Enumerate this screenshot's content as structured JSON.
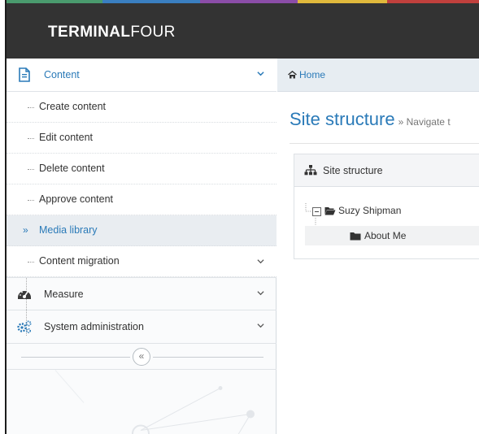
{
  "header": {
    "logo_bold": "TERMINAL",
    "logo_light": "FOUR",
    "stripe_colors": [
      "#4a9b6e",
      "#3a7fc1",
      "#8b4da8",
      "#e0b93c",
      "#c1403d"
    ]
  },
  "sidebar": {
    "sections": [
      {
        "label": "Content",
        "icon": "document-icon",
        "expanded": true
      },
      {
        "label": "Measure",
        "icon": "dashboard-icon",
        "expanded": false
      },
      {
        "label": "System administration",
        "icon": "gears-icon",
        "expanded": false
      }
    ],
    "content_items": [
      {
        "label": "Create content"
      },
      {
        "label": "Edit content"
      },
      {
        "label": "Delete content"
      },
      {
        "label": "Approve content"
      },
      {
        "label": "Media library",
        "selected": true,
        "marker": "»"
      },
      {
        "label": "Content migration",
        "has_children": true
      }
    ],
    "collapse_glyph": "«"
  },
  "breadcrumb": {
    "home_label": "Home"
  },
  "page": {
    "title": "Site structure",
    "subtitle": "» Navigate t"
  },
  "panel": {
    "title": "Site structure",
    "tree": {
      "root_label": "Suzy Shipman",
      "children": [
        {
          "label": "About Me"
        }
      ]
    }
  },
  "colors": {
    "accent": "#2a7ab8",
    "header_bg": "#333333",
    "selected_bg": "#e9edf1"
  }
}
